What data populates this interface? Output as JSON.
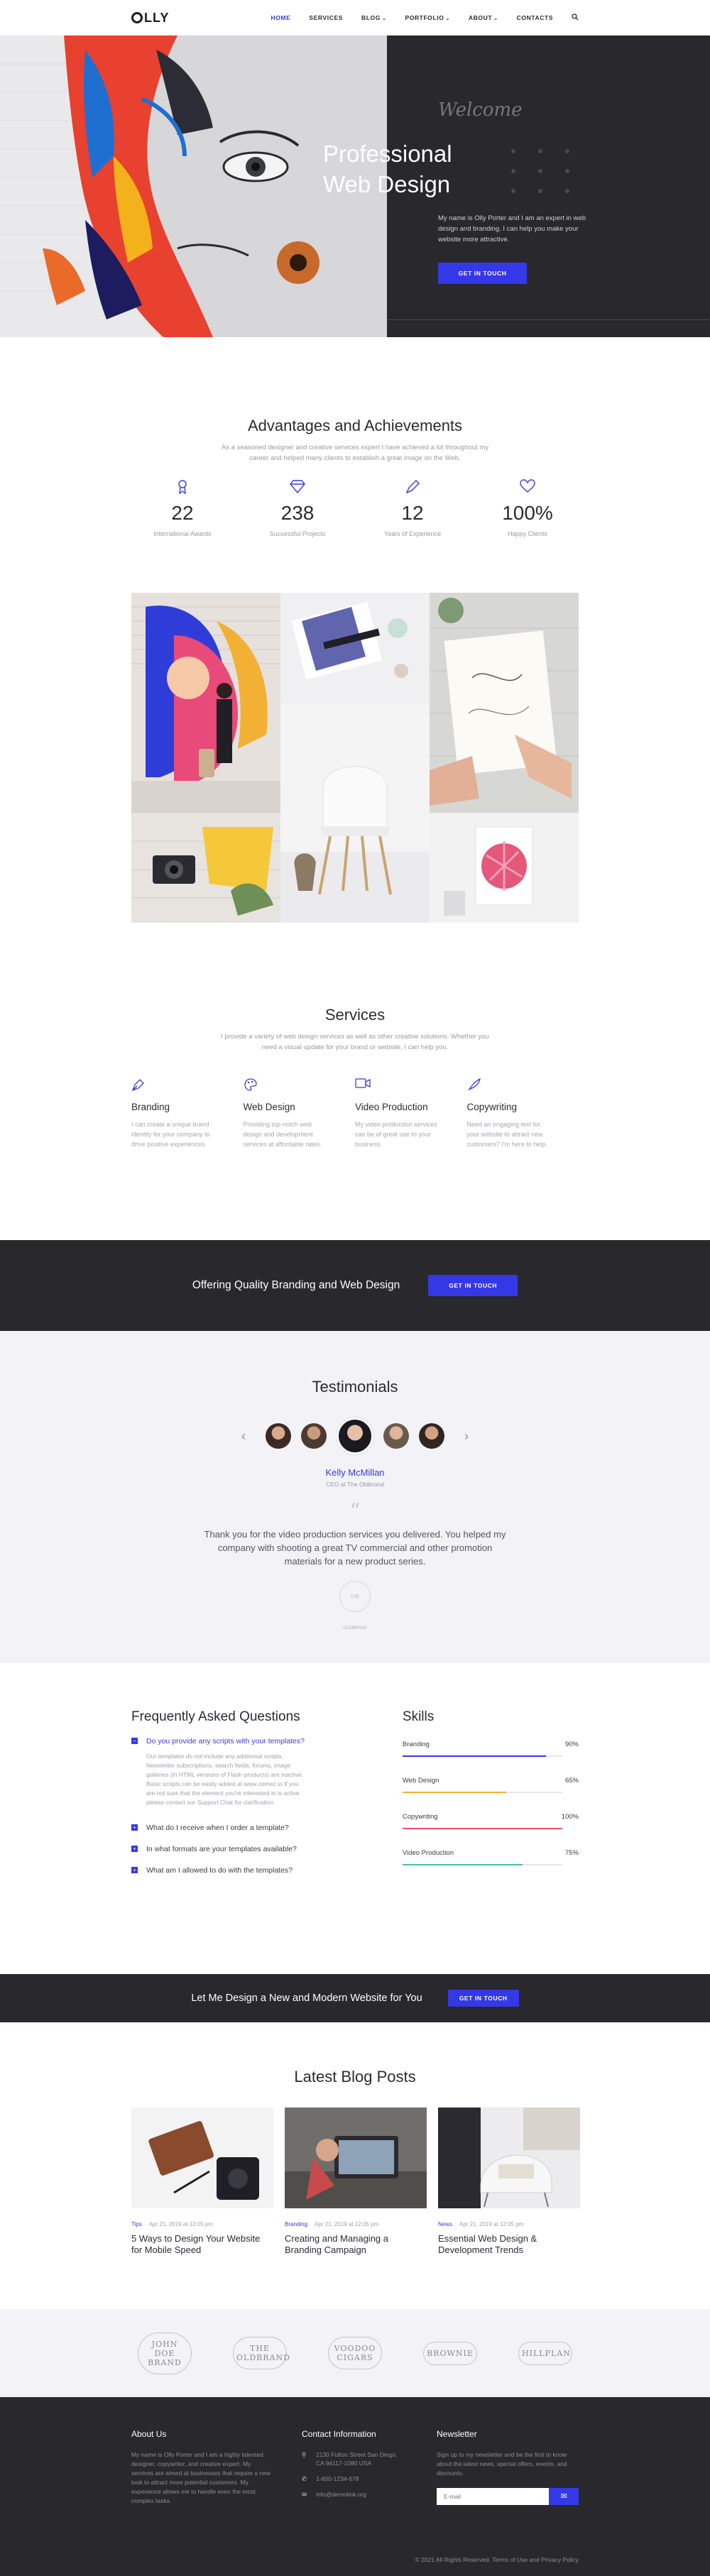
{
  "header": {
    "logo": "LLY",
    "nav": [
      {
        "label": "HOME",
        "active": true,
        "dropdown": false
      },
      {
        "label": "SERVICES",
        "active": false,
        "dropdown": false
      },
      {
        "label": "BLOG",
        "active": false,
        "dropdown": true
      },
      {
        "label": "PORTFOLIO",
        "active": false,
        "dropdown": true
      },
      {
        "label": "ABOUT",
        "active": false,
        "dropdown": true
      },
      {
        "label": "CONTACTS",
        "active": false,
        "dropdown": false
      }
    ]
  },
  "hero": {
    "welcome": "Welcome",
    "title_line1": "Professional",
    "title_line2": "Web Design",
    "text": "My name is Olly Porter and I am an expert in web design and branding. I can help you make your website more attractive.",
    "button": "GET IN TOUCH"
  },
  "achievements": {
    "title": "Advantages and Achievements",
    "subtitle": "As a seasoned designer and creative services expert I have achieved a lot throughout my career and helped many clients to establish a great image on the Web.",
    "stats": [
      {
        "icon": "award-icon",
        "number": "22",
        "label": "International Awards"
      },
      {
        "icon": "diamond-icon",
        "number": "238",
        "label": "Successful Projects"
      },
      {
        "icon": "pen-icon",
        "number": "12",
        "label": "Years of Experience"
      },
      {
        "icon": "heart-icon",
        "number": "100%",
        "label": "Happy Clients"
      }
    ]
  },
  "services": {
    "title": "Services",
    "subtitle": "I provide a variety of web design services as well as other creative solutions. Whether you need a visual update for your brand or website, I can help you.",
    "items": [
      {
        "icon": "pen-nib-icon",
        "title": "Branding",
        "desc": "I can create a unique brand identity for your company to drive positive experiences."
      },
      {
        "icon": "palette-icon",
        "title": "Web Design",
        "desc": "Providing top-notch web design and development services at affordable rates."
      },
      {
        "icon": "video-icon",
        "title": "Video Production",
        "desc": "My video production services can be of great use to your business."
      },
      {
        "icon": "quill-icon",
        "title": "Copywriting",
        "desc": "Need an engaging text for your website to attract new customers? I'm here to help."
      }
    ]
  },
  "cta1": {
    "text": "Offering Quality Branding and Web Design",
    "button": "GET IN TOUCH"
  },
  "testimonials": {
    "title": "Testimonials",
    "name": "Kelly McMillan",
    "role": "CEO at The Oldbrand",
    "quote": "Thank you for the video production services you delivered. You helped my company with shooting a great TV commercial and other promotion materials for a new product series.",
    "logo_text": "THE OLDBRAND"
  },
  "faq": {
    "title": "Frequently Asked Questions",
    "items": [
      {
        "q": "Do you provide any scripts with your templates?",
        "open": true,
        "a": "Our templates do not include any additional scripts. Newsletter subscriptions, search fields, forums, image galleries (in HTML versions of Flash products) are inactive. Basic scripts can be easily added at www.zemez.io If you are not sure that the element you're interested in is active please contact our Support Chat for clarification."
      },
      {
        "q": "What do I receive when I order a template?",
        "open": false,
        "a": ""
      },
      {
        "q": "In what formats are your templates available?",
        "open": false,
        "a": ""
      },
      {
        "q": "What am I allowed to do with the templates?",
        "open": false,
        "a": ""
      }
    ]
  },
  "skills": {
    "title": "Skills",
    "items": [
      {
        "name": "Branding",
        "percent": 90,
        "label": "90%",
        "color": "#3538e6"
      },
      {
        "name": "Web Design",
        "percent": 65,
        "label": "65%",
        "color": "#f2b134"
      },
      {
        "name": "Copywriting",
        "percent": 100,
        "label": "100%",
        "color": "#e8556d"
      },
      {
        "name": "Video Production",
        "percent": 75,
        "label": "75%",
        "color": "#4bc0a3"
      }
    ]
  },
  "cta2": {
    "text": "Let Me Design a New and Modern Website for You",
    "button": "GET IN TOUCH"
  },
  "blog": {
    "title": "Latest Blog Posts",
    "posts": [
      {
        "cat": "Tips",
        "date": "Apr 21, 2019 at 12:05 pm",
        "title": "5 Ways to Design Your Website for Mobile Speed"
      },
      {
        "cat": "Branding",
        "date": "Apr 21, 2019 at 12:05 pm",
        "title": "Creating and Managing a Branding Campaign"
      },
      {
        "cat": "News",
        "date": "Apr 21, 2019 at 12:05 pm",
        "title": "Essential Web Design & Development Trends"
      }
    ]
  },
  "brands": [
    "JOHN DOE BRAND",
    "THE OLDBRAND",
    "VOODOO CIGARS",
    "BROWNIE",
    "HILLPLAN"
  ],
  "footer": {
    "about_title": "About Us",
    "about_text": "My name is Olly Porter and I am a highly talented designer, copywriter, and creative expert. My services are aimed at businesses that require a new look to attract more potential customers. My experience allows me to handle even the most complex tasks.",
    "contact_title": "Contact Information",
    "address": "2130 Fulton Street San Diego, CA 94117-1080 USA",
    "phone": "1-800-1234-678",
    "email": "info@demolink.org",
    "newsletter_title": "Newsletter",
    "newsletter_text": "Sign up to my newsletter and be the first to know about the latest news, special offers, events, and discounts.",
    "email_placeholder": "E-mail",
    "copyright": "© 2021 All Rights Reserved. Terms of Use and Privacy Policy"
  }
}
